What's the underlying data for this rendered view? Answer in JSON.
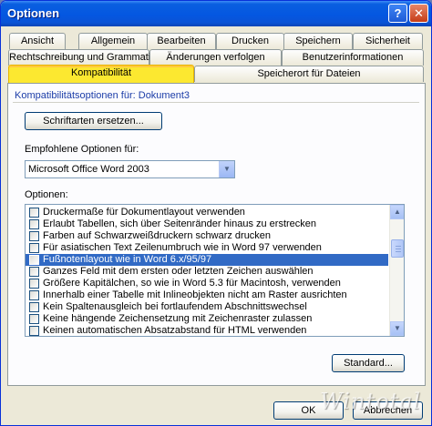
{
  "window": {
    "title": "Optionen"
  },
  "title_buttons": {
    "help": "?",
    "close": "✕"
  },
  "tabs": {
    "row1": [
      "Ansicht",
      "Allgemein",
      "Bearbeiten",
      "Drucken",
      "Speichern",
      "Sicherheit"
    ],
    "row2": [
      "Rechtschreibung und Grammatik",
      "Änderungen verfolgen",
      "Benutzerinformationen"
    ],
    "row3": [
      "Kompatibilität",
      "Speicherort für Dateien"
    ],
    "active": "Kompatibilität"
  },
  "panel": {
    "header": "Kompatibilitätsoptionen für: Dokument3",
    "replace_fonts_button": "Schriftarten ersetzen...",
    "recommended_label": "Empfohlene Optionen für:",
    "recommended_value": "Microsoft Office Word 2003",
    "options_label": "Optionen:",
    "options": [
      "Druckermaße für Dokumentlayout verwenden",
      "Erlaubt Tabellen, sich über Seitenränder hinaus zu erstrecken",
      "Farben auf Schwarzweißdruckern schwarz drucken",
      "Für asiatischen Text Zeilenumbruch wie in Word 97 verwenden",
      "Fußnotenlayout wie in Word 6.x/95/97",
      "Ganzes Feld mit dem ersten oder letzten Zeichen auswählen",
      "Größere Kapitälchen, so wie in Word 5.3 für Macintosh, verwenden",
      "Innerhalb einer Tabelle mit  Inlineobjekten nicht am Raster ausrichten",
      "Kein Spaltenausgleich bei fortlaufendem Abschnittswechsel",
      "Keine hängende Zeichensetzung mit Zeichenraster zulassen",
      "Keinen automatischen Absatzabstand für HTML verwenden"
    ],
    "selected_index": 4,
    "standard_button": "Standard..."
  },
  "footer": {
    "ok": "OK",
    "cancel": "Abbrechen"
  },
  "watermark": "Wintotal"
}
